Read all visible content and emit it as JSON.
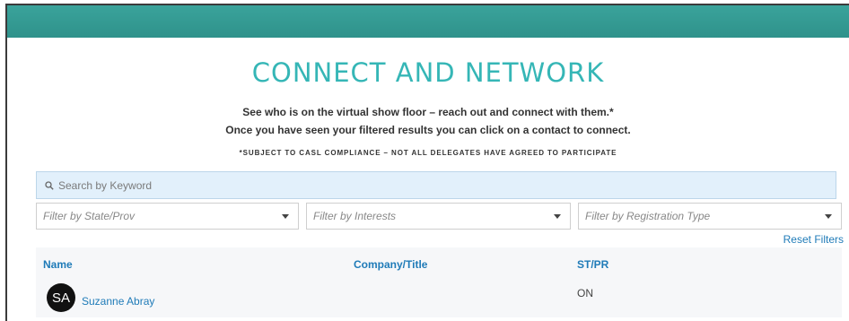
{
  "header": {
    "title": "CONNECT AND NETWORK",
    "intro_line_1": "See who is on the virtual show floor – reach out and connect with them.*",
    "intro_line_2": "Once you have seen your filtered results you can click on a contact to connect.",
    "casl_note": "*SUBJECT TO CASL COMPLIANCE – NOT ALL DELEGATES HAVE AGREED TO PARTICIPATE"
  },
  "search": {
    "placeholder": "Search by Keyword",
    "value": "",
    "icon": "search-icon"
  },
  "filters": {
    "state_prov": "Filter by State/Prov",
    "interests": "Filter by Interests",
    "registration_type": "Filter by Registration Type",
    "reset_label": "Reset Filters"
  },
  "table": {
    "columns": [
      "Name",
      "Company/Title",
      "ST/PR"
    ],
    "rows": [
      {
        "initials": "SA",
        "name": "Suzanne Abray",
        "company_title": "",
        "st_pr": "ON"
      }
    ]
  },
  "colors": {
    "top_band": "#3aa39b",
    "title": "#35b6b6",
    "link": "#1f7bb8",
    "search_bg": "#e2f0fb",
    "avatar_bg": "#111111"
  }
}
